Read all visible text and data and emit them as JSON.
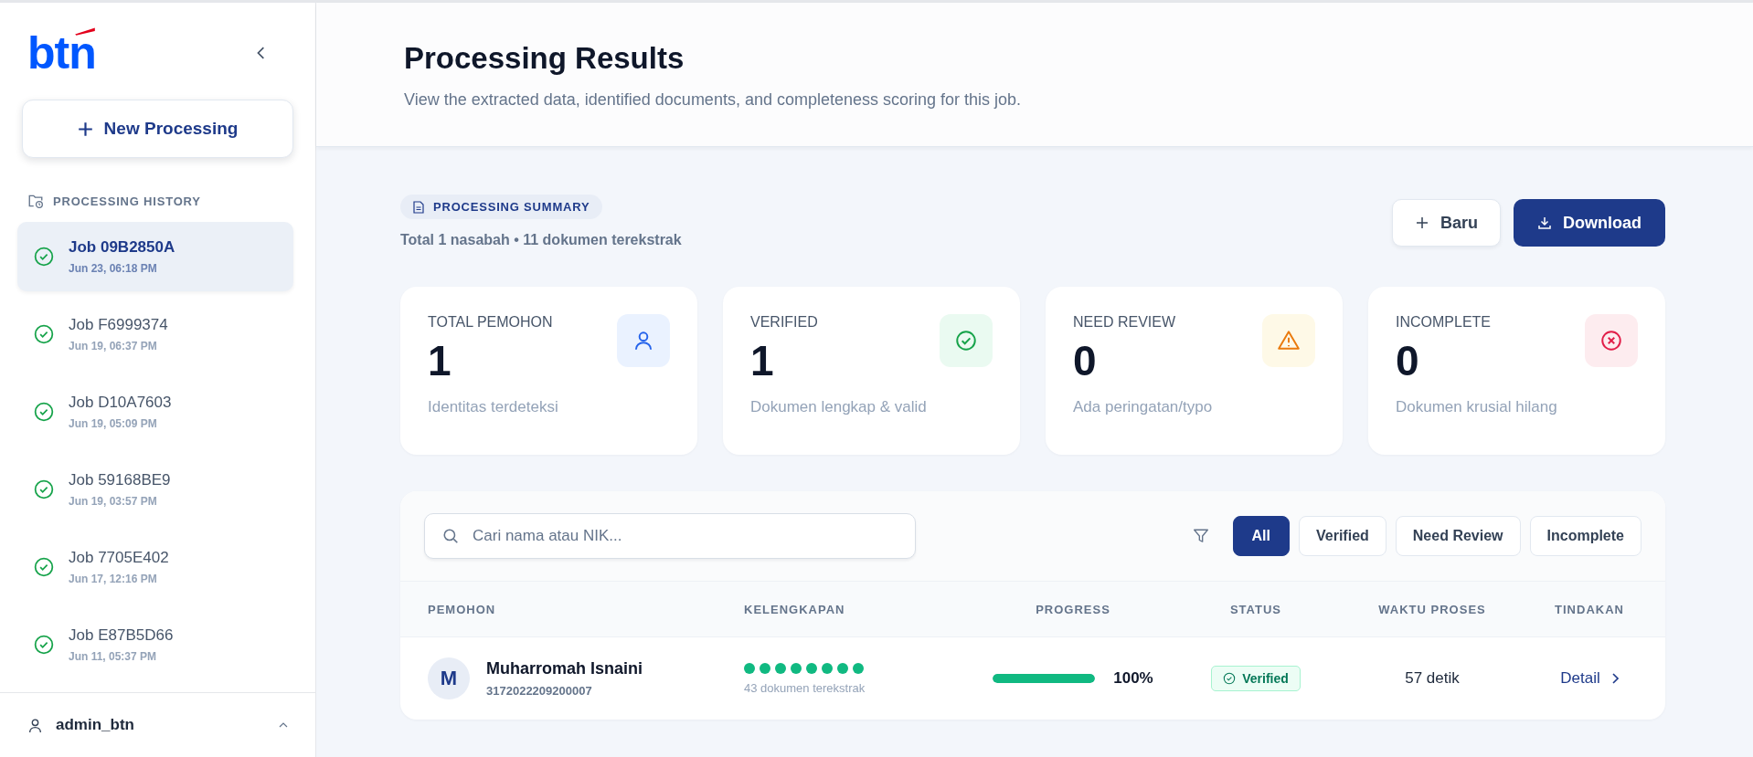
{
  "sidebar": {
    "logo": "btn",
    "new_button": "New Processing",
    "history_title": "PROCESSING HISTORY",
    "jobs": [
      {
        "name": "Job 09B2850A",
        "date": "Jun 23, 06:18 PM",
        "selected": true
      },
      {
        "name": "Job F6999374",
        "date": "Jun 19, 06:37 PM",
        "selected": false
      },
      {
        "name": "Job D10A7603",
        "date": "Jun 19, 05:09 PM",
        "selected": false
      },
      {
        "name": "Job 59168BE9",
        "date": "Jun 19, 03:57 PM",
        "selected": false
      },
      {
        "name": "Job 7705E402",
        "date": "Jun 17, 12:16 PM",
        "selected": false
      },
      {
        "name": "Job E87B5D66",
        "date": "Jun 11, 05:37 PM",
        "selected": false
      }
    ],
    "user": "admin_btn"
  },
  "header": {
    "title": "Processing Results",
    "subtitle": "View the extracted data, identified documents, and completeness scoring for this job."
  },
  "summary": {
    "badge": "PROCESSING SUMMARY",
    "text": "Total 1 nasabah • 11 dokumen terekstrak",
    "buttons": [
      {
        "label": "Baru",
        "kind": "secondary"
      },
      {
        "label": "Download",
        "kind": "primary"
      }
    ]
  },
  "cards": [
    {
      "label": "TOTAL PEMOHON",
      "value": "1",
      "note": "Identitas terdeteksi",
      "kind": "person"
    },
    {
      "label": "VERIFIED",
      "value": "1",
      "note": "Dokumen lengkap & valid",
      "kind": "verified"
    },
    {
      "label": "NEED REVIEW",
      "value": "0",
      "note": "Ada peringatan/typo",
      "kind": "warning"
    },
    {
      "label": "INCOMPLETE",
      "value": "0",
      "note": "Dokumen krusial hilang",
      "kind": "incomplete"
    }
  ],
  "table": {
    "search": {
      "placeholder": "Cari nama atau NIK..."
    },
    "filters": [
      {
        "label": "All",
        "selected": true
      },
      {
        "label": "Verified",
        "selected": false
      },
      {
        "label": "Need Review",
        "selected": false
      },
      {
        "label": "Incomplete",
        "selected": false
      }
    ],
    "columns": [
      "PEMOHON",
      "KELENGKAPAN",
      "PROGRESS",
      "STATUS",
      "WAKTU PROSES",
      "TINDAKAN"
    ],
    "rows": [
      {
        "initial": "M",
        "name": "Muharromah Isnaini",
        "nik": "3172022209200007",
        "dots": [
          {
            "filled": true
          },
          {
            "filled": true
          },
          {
            "filled": true
          },
          {
            "filled": true
          },
          {
            "filled": true
          },
          {
            "filled": true
          },
          {
            "filled": true
          },
          {
            "filled": true
          }
        ],
        "docs": "43 dokumen terekstrak",
        "level": 1,
        "percent": "100%",
        "status": {
          "label": "Verified",
          "kind": "verified"
        },
        "time": "57 detik",
        "action": "Detail"
      }
    ]
  }
}
